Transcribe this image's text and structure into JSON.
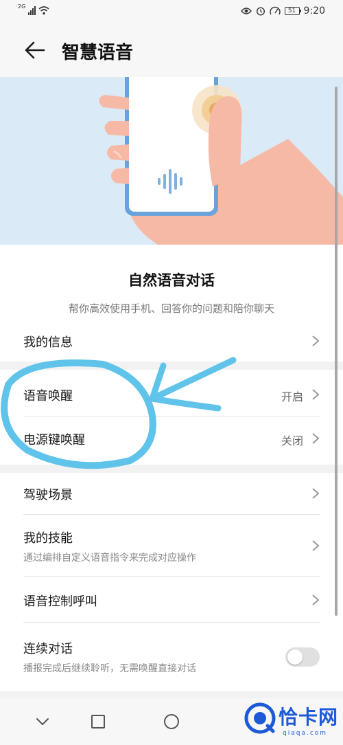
{
  "status_bar": {
    "network": "2G",
    "time": "9:20",
    "battery": "51",
    "icons": [
      "eye-comfort-icon",
      "alarm-icon",
      "nfc-icon"
    ]
  },
  "header": {
    "back_icon": "arrow-left-icon",
    "title": "智慧语音"
  },
  "intro": {
    "title": "自然语音对话",
    "subtitle": "帮你高效使用手机、回答你的问题和陪你聊天"
  },
  "settings": {
    "my_info": {
      "label": "我的信息"
    },
    "voice_wakeup": {
      "label": "语音唤醒",
      "value": "开启"
    },
    "power_key_wakeup": {
      "label": "电源键唤醒",
      "value": "关闭"
    },
    "driving_scene": {
      "label": "驾驶场景"
    },
    "my_skills": {
      "label": "我的技能",
      "subtitle": "通过编排自定义语音指令来完成对应操作"
    },
    "voice_call": {
      "label": "语音控制呼叫"
    },
    "continuous_dialog": {
      "label": "连续对话",
      "subtitle": "播报完成后继续聆听，无需唤醒直接对话",
      "enabled": false
    }
  },
  "nav_bar": {
    "buttons": [
      "back-triangle-icon",
      "home-circle-icon",
      "recent-square-icon"
    ]
  },
  "watermark": {
    "text": "恰卡网",
    "sub": "qiaqa.com"
  },
  "colors": {
    "hero_bg": "#dbeaf7",
    "phone_frame": "#6aa3da",
    "hand": "#f6b9a5",
    "annotation": "#5fc3ea",
    "toggle_off": "#e0e0e0",
    "watermark": "#1c5ad6"
  }
}
